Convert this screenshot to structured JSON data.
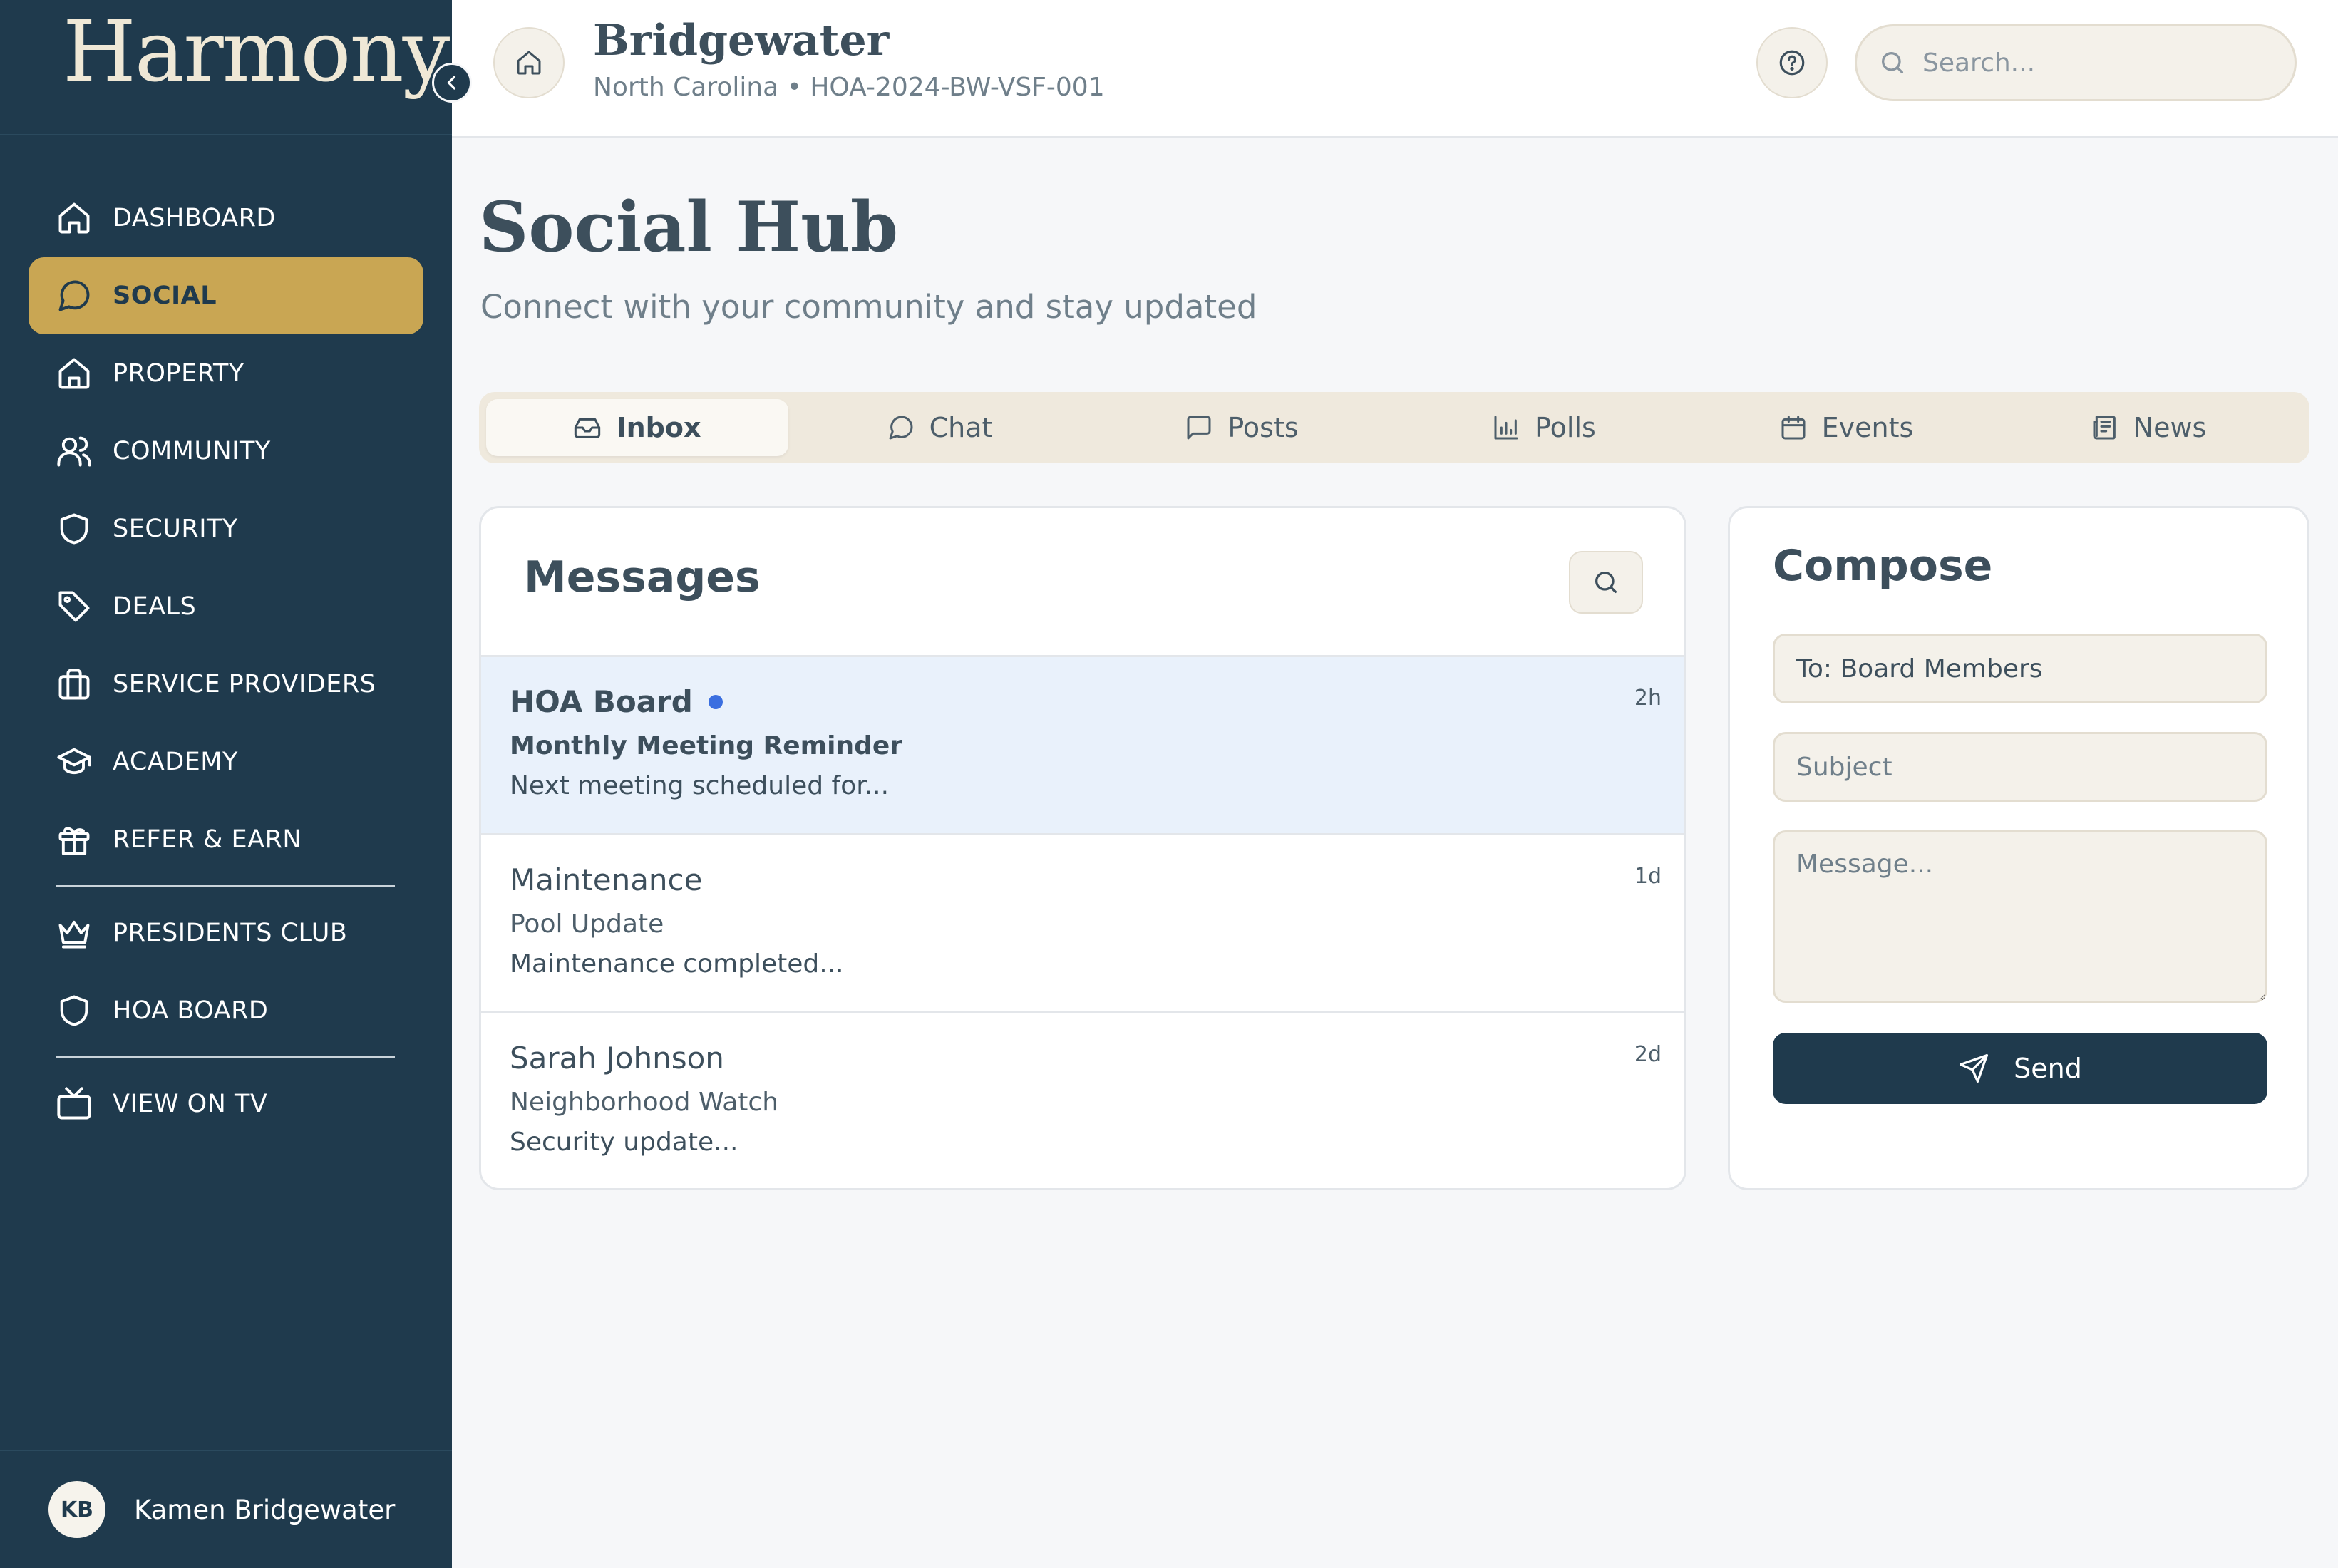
{
  "sidebar": {
    "logo": "Harmony",
    "collapse_icon": "chevron-left-icon",
    "items": [
      {
        "label": "DASHBOARD",
        "icon": "home-icon",
        "active": false
      },
      {
        "label": "SOCIAL",
        "icon": "chat-bubble-icon",
        "active": true
      },
      {
        "label": "PROPERTY",
        "icon": "house-icon",
        "active": false
      },
      {
        "label": "COMMUNITY",
        "icon": "users-icon",
        "active": false
      },
      {
        "label": "SECURITY",
        "icon": "shield-icon",
        "active": false
      },
      {
        "label": "DEALS",
        "icon": "tag-icon",
        "active": false
      },
      {
        "label": "SERVICE PROVIDERS",
        "icon": "briefcase-icon",
        "active": false
      },
      {
        "label": "ACADEMY",
        "icon": "graduation-cap-icon",
        "active": false
      },
      {
        "label": "REFER & EARN",
        "icon": "gift-icon",
        "active": false
      },
      {
        "label": "PRESIDENTS CLUB",
        "icon": "crown-icon",
        "active": false
      },
      {
        "label": "HOA BOARD",
        "icon": "shield-icon",
        "active": false
      },
      {
        "label": "VIEW ON TV",
        "icon": "tv-icon",
        "active": false
      }
    ],
    "user": {
      "initials": "KB",
      "name": "Kamen Bridgewater"
    }
  },
  "header": {
    "org_name": "Bridgewater",
    "org_sub": "North Carolina • HOA-2024-BW-VSF-001",
    "search_placeholder": "Search..."
  },
  "page": {
    "title": "Social Hub",
    "subtitle": "Connect with your community and stay updated"
  },
  "tabs": [
    {
      "label": "Inbox",
      "icon": "inbox-icon",
      "active": true
    },
    {
      "label": "Chat",
      "icon": "chat-bubble-icon",
      "active": false
    },
    {
      "label": "Posts",
      "icon": "message-square-icon",
      "active": false
    },
    {
      "label": "Polls",
      "icon": "bar-chart-icon",
      "active": false
    },
    {
      "label": "Events",
      "icon": "calendar-icon",
      "active": false
    },
    {
      "label": "News",
      "icon": "newspaper-icon",
      "active": false
    }
  ],
  "messages": {
    "title": "Messages",
    "items": [
      {
        "sender": "HOA Board",
        "subject": "Monthly Meeting Reminder",
        "preview": "Next meeting scheduled for...",
        "time": "2h",
        "unread": true
      },
      {
        "sender": "Maintenance",
        "subject": "Pool Update",
        "preview": "Maintenance completed...",
        "time": "1d",
        "unread": false
      },
      {
        "sender": "Sarah Johnson",
        "subject": "Neighborhood Watch",
        "preview": "Security update...",
        "time": "2d",
        "unread": false
      }
    ]
  },
  "compose": {
    "title": "Compose",
    "to_value": "To: Board Members",
    "subject_placeholder": "Subject",
    "message_placeholder": "Message...",
    "send_label": "Send"
  },
  "colors": {
    "sidebar_bg": "#1f3a4d",
    "accent_gold": "#c9a653",
    "unread_bg": "#e9f1fb",
    "unread_dot": "#3b6fe0"
  }
}
